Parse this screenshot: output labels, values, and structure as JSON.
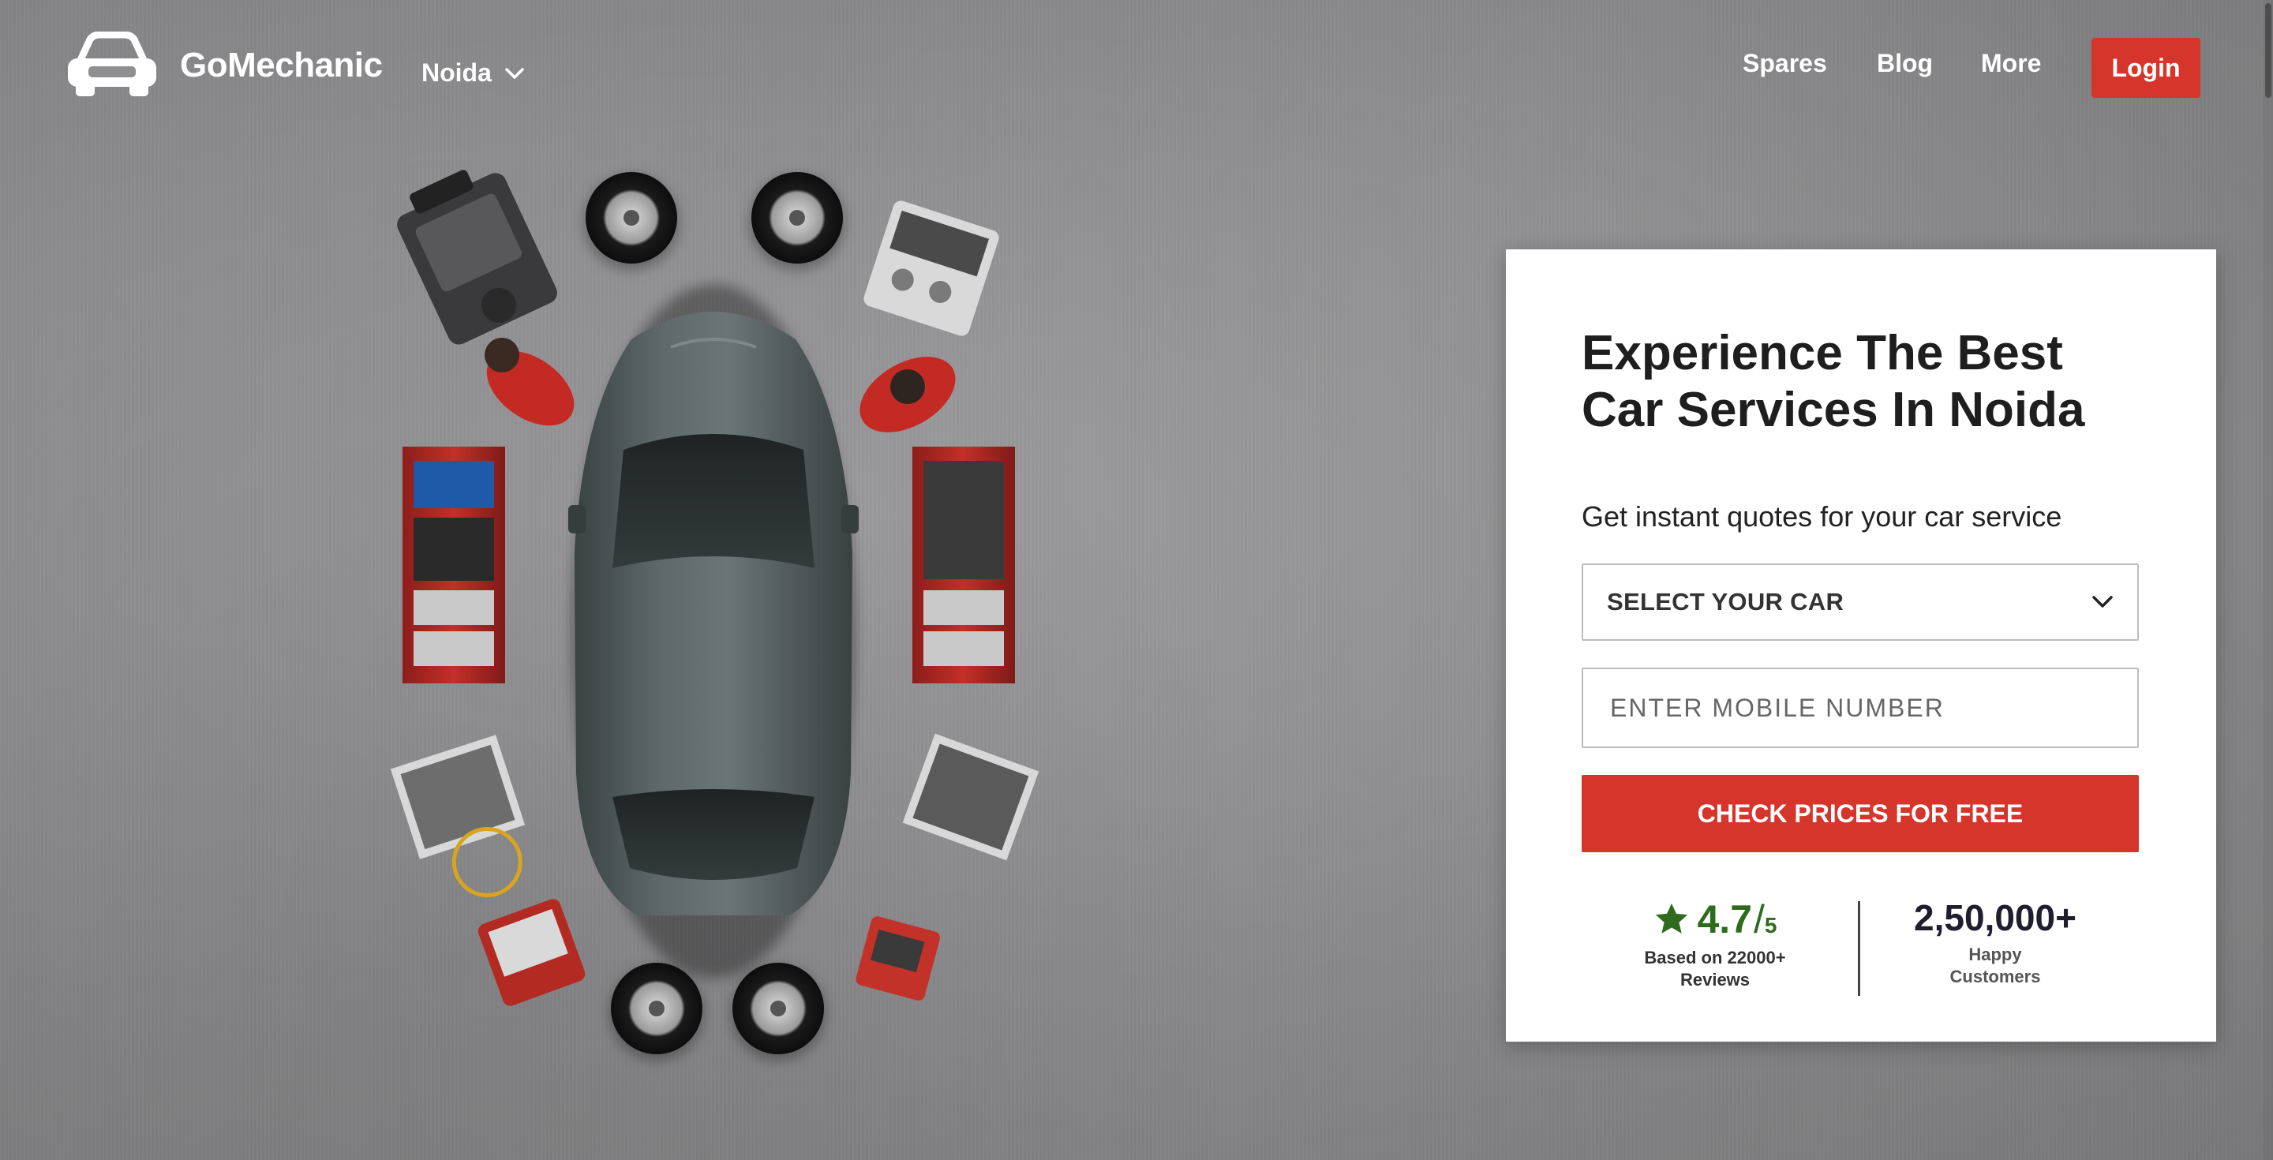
{
  "header": {
    "brand": "GoMechanic",
    "city": "Noida",
    "nav": [
      "Spares",
      "Blog",
      "More"
    ],
    "login_label": "Login"
  },
  "card": {
    "title": "Experience The Best Car Services In Noida",
    "subtitle": "Get instant quotes for your car service",
    "select_car_label": "SELECT YOUR CAR",
    "mobile_placeholder": "ENTER MOBILE NUMBER",
    "cta_label": "CHECK PRICES FOR FREE",
    "rating": {
      "value": "4.7",
      "slash": "/",
      "max": "5",
      "note_line1": "Based on 22000+",
      "note_line2": "Reviews"
    },
    "customers": {
      "value": "2,50,000+",
      "note_line1": "Happy",
      "note_line2": "Customers"
    }
  },
  "colors": {
    "accent": "#d6352b",
    "rating_green": "#2e6b1d",
    "background": "#8f8f91"
  },
  "icons": [
    "car-logo-icon",
    "chevron-down-icon",
    "star-icon"
  ]
}
